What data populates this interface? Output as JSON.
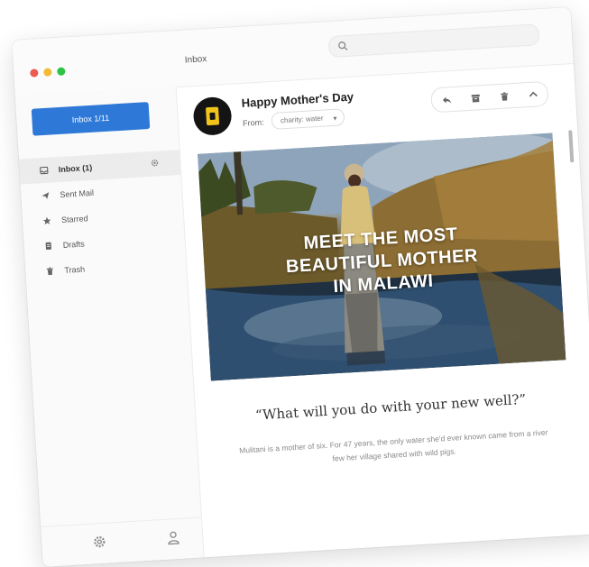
{
  "window": {
    "title": "Inbox",
    "search": {
      "placeholder": ""
    }
  },
  "sidebar": {
    "compose_label": "Inbox 1/11",
    "items": [
      {
        "label": "Inbox (1)",
        "icon": "inbox-icon"
      },
      {
        "label": "Sent Mail",
        "icon": "sent-icon"
      },
      {
        "label": "Starred",
        "icon": "star-icon"
      },
      {
        "label": "Drafts",
        "icon": "drafts-icon"
      },
      {
        "label": "Trash",
        "icon": "trash-icon"
      }
    ],
    "footer": {
      "icons": [
        "gear-icon",
        "user-icon"
      ]
    }
  },
  "message": {
    "subject": "Happy Mother's Day",
    "from_label": "From:",
    "from_value": "charity: water",
    "actions": [
      "reply-icon",
      "archive-icon",
      "delete-icon",
      "more-icon"
    ],
    "hero": {
      "headline_lines": [
        "MEET THE MOST",
        "BEAUTIFUL MOTHER",
        "IN MALAWI"
      ]
    },
    "quote": "“What will you do with your new well?”",
    "body": "Mulitani is a mother of six. For 47 years, the only water she'd ever known came from a river few her village shared with wild pigs."
  },
  "colors": {
    "accent": "#2e79d8",
    "traffic_red": "#ec5a50",
    "traffic_yellow": "#f1bb36",
    "traffic_green": "#2fc244",
    "brand_yellow": "#f2c41b"
  }
}
